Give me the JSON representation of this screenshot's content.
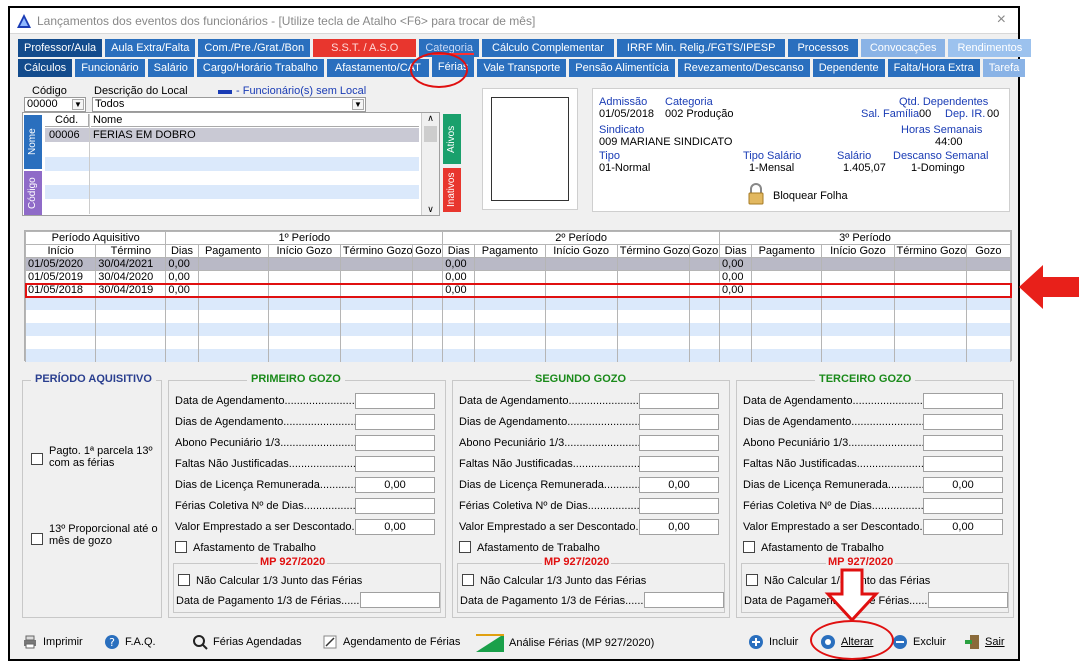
{
  "window": {
    "title": "Lançamentos dos eventos dos funcionários - [Utilize tecla de Atalho <F6> para trocar de mês]",
    "close": "×"
  },
  "tabs_row1": [
    "Professor/Aula",
    "Aula Extra/Falta",
    "Com./Pre./Grat./Bon",
    "S.S.T. / A.S.O",
    "Categoria",
    "Cálculo Complementar",
    "IRRF Min. Relig./FGTS/IPESP",
    "Processos",
    "Convocações",
    "Rendimentos"
  ],
  "tabs_row2": [
    "Cálculos",
    "Funcionário",
    "Salário",
    "Cargo/Horário Trabalho",
    "Afastamento/CAT",
    "Férias",
    "Vale Transporte",
    "Pensão Alimentícia",
    "Revezamento/Descanso",
    "Dependente",
    "Falta/Hora Extra",
    "Tarefa"
  ],
  "filter": {
    "codigo_label": "Código",
    "codigo_value": "00000",
    "local_label": "Descrição do Local",
    "local_value": "Todos",
    "legend": "- Funcionário(s) sem Local"
  },
  "employees": {
    "col_cod": "Cód.",
    "col_nome": "Nome",
    "rows": [
      {
        "cod": "00006",
        "nome": "FERIAS EM DOBRO"
      }
    ],
    "side_nome": "Nome",
    "side_codigo": "Código",
    "side_ativos": "Ativos",
    "side_inativos": "Inativos"
  },
  "info": {
    "admissao_label": "Admissão",
    "admissao": "01/05/2018",
    "categoria_label": "Categoria",
    "categoria": "002  Produção",
    "qtd_dep_label": "Qtd. Dependentes",
    "sal_familia_label": "Sal. Família",
    "sal_familia": "00",
    "dep_ir_label": "Dep. IR.",
    "dep_ir": "00",
    "sindicato_label": "Sindicato",
    "sindicato": "009  MARIANE SINDICATO",
    "horas_label": "Horas Semanais",
    "horas": "44:00",
    "tipo_label": "Tipo",
    "tipo": "01-Normal",
    "tipo_salario_label": "Tipo Salário",
    "tipo_salario": "1-Mensal",
    "salario_label": "Salário",
    "salario": "1.405,07",
    "descanso_label": "Descanso Semanal",
    "descanso": "1-Domingo",
    "bloquear": "Bloquear Folha"
  },
  "periods": {
    "group_aquisitivo": "Período Aquisitivo",
    "group_1": "1º Período",
    "group_2": "2º Período",
    "group_3": "3º Período",
    "inicio": "Início",
    "termino": "Término",
    "dias": "Dias",
    "pagamento": "Pagamento",
    "inicio_gozo": "Início Gozo",
    "termino_gozo": "Término Gozo",
    "gozo": "Gozo",
    "rows": [
      {
        "inicio": "01/05/2020",
        "termino": "30/04/2021",
        "d1": "0,00",
        "d2": "0,00",
        "d3": "0,00"
      },
      {
        "inicio": "01/05/2019",
        "termino": "30/04/2020",
        "d1": "0,00",
        "d2": "0,00",
        "d3": "0,00"
      },
      {
        "inicio": "01/05/2018",
        "termino": "30/04/2019",
        "d1": "0,00",
        "d2": "0,00",
        "d3": "0,00"
      }
    ]
  },
  "aquisitivo": {
    "title": "PERÍODO AQUISITIVO",
    "pagto": "Pagto. 1ª parcela 13º com as férias",
    "proporcional": "13º Proporcional até o mês de gozo"
  },
  "gozo_sections": [
    {
      "title": "PRIMEIRO GOZO"
    },
    {
      "title": "SEGUNDO GOZO"
    },
    {
      "title": "TERCEIRO GOZO"
    }
  ],
  "gozo_fields": {
    "data_agendamento": "Data de Agendamento........................",
    "dias_agendamento": "Dias de Agendamento..........................",
    "abono": "Abono Pecuniário 1/3...............................",
    "faltas": "Faltas Não Justificadas.............................",
    "licenca": "Dias de Licença Remunerada.............",
    "coletiva": "Férias Coletiva Nº de Dias...................",
    "emprestado": "Valor Emprestado a ser Descontado..",
    "afastamento": "Afastamento de Trabalho",
    "mp": "MP 927/2020",
    "nao_calcular": "Não Calcular 1/3 Junto das Férias",
    "data_pagamento": "Data de Pagamento 1/3 de Férias.......",
    "zero": "0,00"
  },
  "toolbar": {
    "imprimir": "Imprimir",
    "faq": "F.A.Q.",
    "ferias_agendadas": "Férias Agendadas",
    "agendamento": "Agendamento de Férias",
    "analise": "Análise Férias (MP 927/2020)",
    "incluir": "Incluir",
    "alterar": "Alterar",
    "excluir": "Excluir",
    "sair": "Sair"
  },
  "colors": {
    "accent": "#2a6fbe",
    "annotation": "#e01010",
    "blue_text": "#1a3cb5"
  }
}
